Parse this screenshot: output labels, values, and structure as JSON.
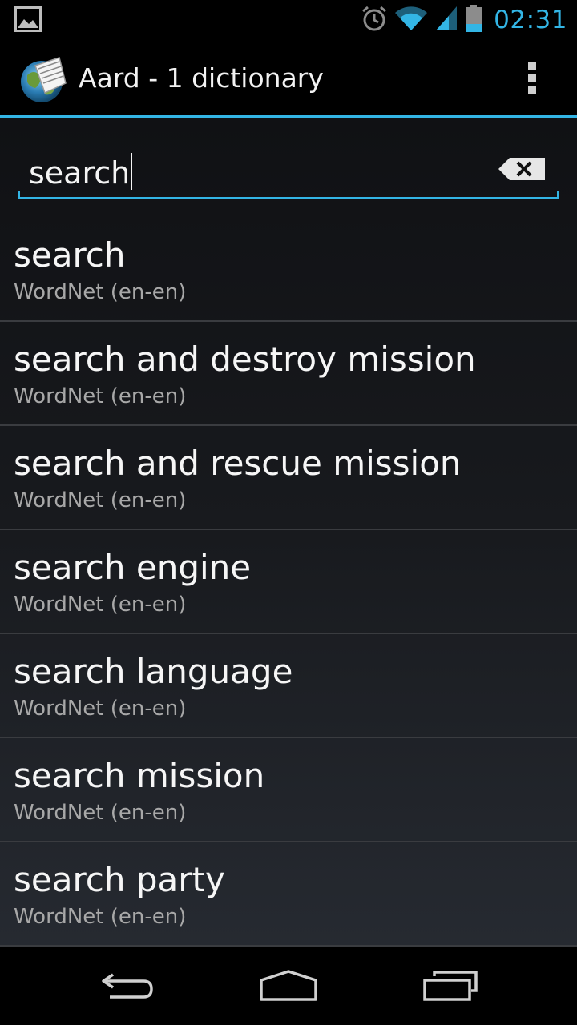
{
  "status_bar": {
    "time": "02:31",
    "icons": [
      "picture-notification-icon",
      "alarm-icon",
      "wifi-icon",
      "cell-signal-icon",
      "battery-icon"
    ]
  },
  "action_bar": {
    "app_icon": "aard-globe-book-icon",
    "title": "Aard - 1 dictionary",
    "overflow_icon": "overflow-menu-icon"
  },
  "search": {
    "value": "search",
    "clear_icon": "clear-text-icon"
  },
  "results": [
    {
      "word": "search",
      "source": "WordNet (en-en)"
    },
    {
      "word": "search and destroy mission",
      "source": "WordNet (en-en)"
    },
    {
      "word": "search and rescue mission",
      "source": "WordNet (en-en)"
    },
    {
      "word": "search engine",
      "source": "WordNet (en-en)"
    },
    {
      "word": "search language",
      "source": "WordNet (en-en)"
    },
    {
      "word": "search mission",
      "source": "WordNet (en-en)"
    },
    {
      "word": "search party",
      "source": "WordNet (en-en)"
    }
  ],
  "nav_bar": {
    "icons": [
      "back-icon",
      "home-icon",
      "recent-apps-icon"
    ]
  },
  "colors": {
    "accent": "#33b5e5",
    "background_top": "#101114",
    "background_bottom": "#262a31",
    "secondary_text": "#a8a8a8",
    "divider": "#3a3c40"
  }
}
